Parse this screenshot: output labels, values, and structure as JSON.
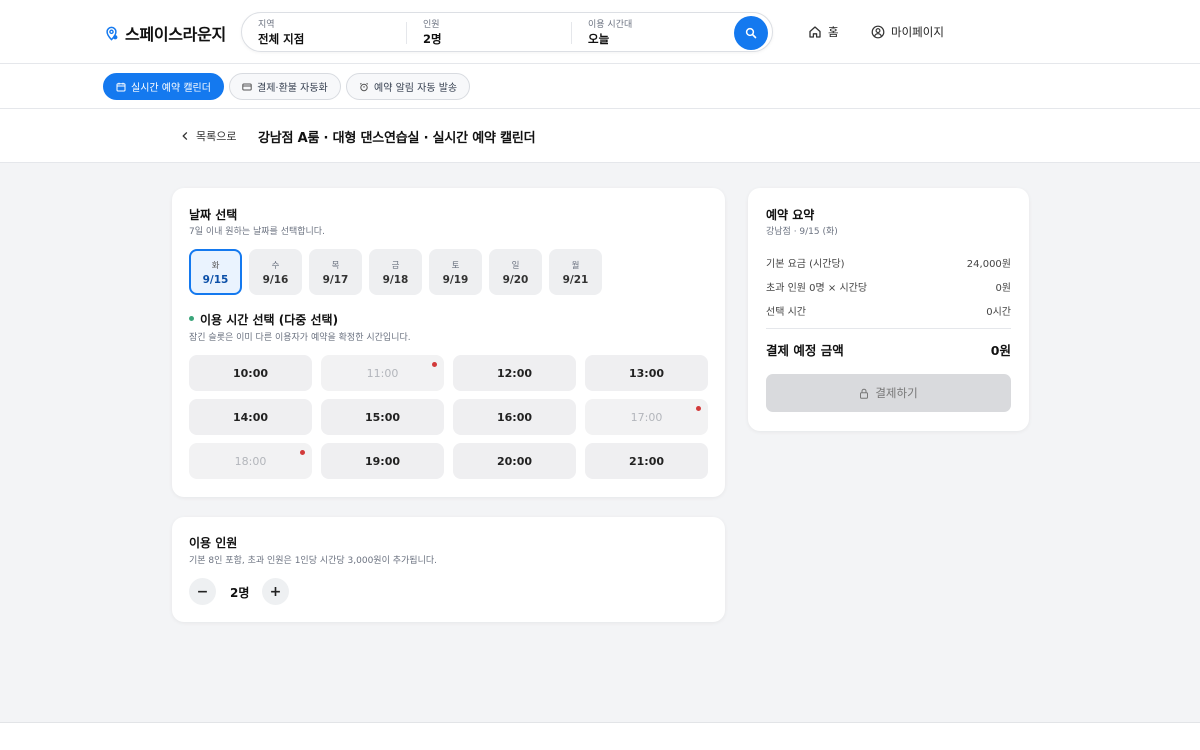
{
  "header": {
    "logo": "스페이스라운지",
    "search": {
      "region_label": "지역",
      "region_value": "전체 지점",
      "people_label": "인원",
      "people_value": "2명",
      "time_label": "이용 시간대",
      "time_value": "오늘"
    },
    "nav": {
      "home": "홈",
      "mypage": "마이페이지"
    }
  },
  "feature_tabs": [
    "실시간 예약 캘린더",
    "결제·환불 자동화",
    "예약 알림 자동 발송"
  ],
  "title_bar": {
    "back": "목록으로",
    "title": "강남점 A룸 · 대형 댄스연습실 · 실시간 예약 캘린더"
  },
  "date_section": {
    "title": "날짜 선택",
    "desc": "7일 이내 원하는 날짜를 선택합니다.",
    "dates": [
      {
        "dow": "화",
        "date": "9/15",
        "selected": true
      },
      {
        "dow": "수",
        "date": "9/16"
      },
      {
        "dow": "목",
        "date": "9/17"
      },
      {
        "dow": "금",
        "date": "9/18"
      },
      {
        "dow": "토",
        "date": "9/19"
      },
      {
        "dow": "일",
        "date": "9/20"
      },
      {
        "dow": "월",
        "date": "9/21"
      }
    ]
  },
  "time_section": {
    "title": "이용 시간 선택 (다중 선택)",
    "desc": "잠긴 슬롯은 이미 다른 이용자가 예약을 확정한 시간입니다.",
    "slots": [
      {
        "time": "10:00",
        "locked": false
      },
      {
        "time": "11:00",
        "locked": true
      },
      {
        "time": "12:00",
        "locked": false
      },
      {
        "time": "13:00",
        "locked": false
      },
      {
        "time": "14:00",
        "locked": false
      },
      {
        "time": "15:00",
        "locked": false
      },
      {
        "time": "16:00",
        "locked": false
      },
      {
        "time": "17:00",
        "locked": true
      },
      {
        "time": "18:00",
        "locked": true
      },
      {
        "time": "19:00",
        "locked": false
      },
      {
        "time": "20:00",
        "locked": false
      },
      {
        "time": "21:00",
        "locked": false
      }
    ]
  },
  "people_section": {
    "title": "이용 인원",
    "desc": "기본 8인 포함, 초과 인원은 1인당 시간당 3,000원이 추가됩니다.",
    "minus": "−",
    "plus": "+",
    "count": "2명"
  },
  "summary": {
    "title": "예약 요약",
    "subtitle": "강남점 · 9/15 (화)",
    "rows": [
      {
        "label": "기본 요금 (시간당)",
        "value": "24,000원"
      },
      {
        "label": "초과 인원 0명 × 시간당",
        "value": "0원"
      },
      {
        "label": "선택 시간",
        "value": "0시간"
      }
    ],
    "total_label": "결제 예정 금액",
    "total_value": "0원",
    "pay_button": "결제하기"
  },
  "colors": {
    "accent": "#1479ef",
    "lock_dot": "#d23a3a",
    "status_dot": "#3aa57a"
  }
}
